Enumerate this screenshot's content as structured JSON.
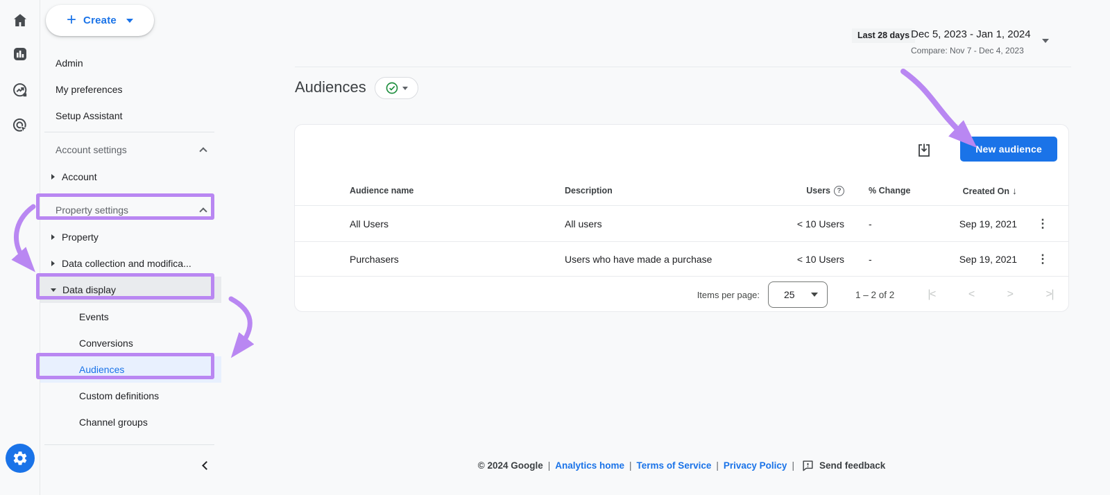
{
  "colors": {
    "primary_blue": "#1a73e8",
    "annotation_purple": "#b987f2",
    "active_item_bg": "#e8f0fe",
    "hover_item_bg": "#e9ebee",
    "success_green": "#1e8e3e",
    "chip_bg": "#f1f3f4"
  },
  "icons": {
    "plus": "+",
    "kebab": "⋮",
    "sort_desc": "↓",
    "help": "?",
    "nav_first": "|<",
    "nav_prev": "<",
    "nav_next": ">",
    "nav_last": ">|",
    "rail": [
      "home-icon",
      "reports-icon",
      "explore-icon",
      "advertising-icon",
      "settings-gear-icon"
    ]
  },
  "create": {
    "label": "Create"
  },
  "sidebar": {
    "top_items": [
      "Admin",
      "My preferences",
      "Setup Assistant"
    ],
    "account_section_label": "Account settings",
    "account_item": "Account",
    "property_section_label": "Property settings",
    "property_items": [
      "Property",
      "Data collection and modifica...",
      "Data display"
    ],
    "data_display_children": [
      "Events",
      "Conversions",
      "Audiences",
      "Custom definitions",
      "Channel groups"
    ],
    "active_item": "Audiences"
  },
  "datebar": {
    "preset": "Last 28 days",
    "range": "Dec 5, 2023 - Jan 1, 2024",
    "compare": "Compare: Nov 7 - Dec 4, 2023"
  },
  "page": {
    "title": "Audiences"
  },
  "audiences_card": {
    "new_audience_label": "New audience",
    "columns": {
      "name": "Audience name",
      "description": "Description",
      "users": "Users",
      "change": "% Change",
      "created": "Created On"
    },
    "rows": [
      {
        "name": "All Users",
        "description": "All users",
        "users": "< 10 Users",
        "change": "-",
        "created": "Sep 19, 2021"
      },
      {
        "name": "Purchasers",
        "description": "Users who have made a purchase",
        "users": "< 10 Users",
        "change": "-",
        "created": "Sep 19, 2021"
      }
    ],
    "pagination": {
      "label": "Items per page:",
      "value": "25",
      "range": "1 – 2 of 2"
    }
  },
  "footer": {
    "copyright": "© 2024 Google",
    "sep": "|",
    "links": [
      "Analytics home",
      "Terms of Service",
      "Privacy Policy"
    ],
    "feedback_label": "Send feedback"
  }
}
